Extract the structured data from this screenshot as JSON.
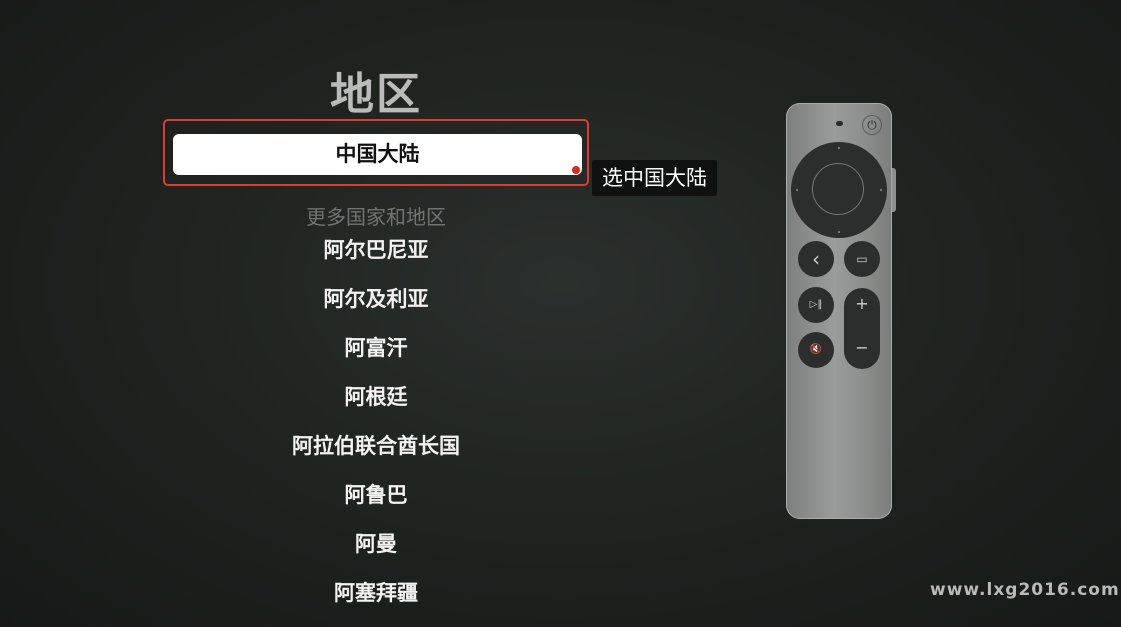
{
  "page": {
    "title": "地区",
    "selected_item": "中国大陆",
    "callout": "选中国大陆",
    "section_header": "更多国家和地区"
  },
  "countries": [
    "阿尔巴尼亚",
    "阿尔及利亚",
    "阿富汗",
    "阿根廷",
    "阿拉伯联合酋长国",
    "阿鲁巴",
    "阿曼",
    "阿塞拜疆"
  ],
  "remote": {
    "back_glyph": "‹",
    "tv_glyph": "▭",
    "playpause_glyph": "▷‖",
    "mute_glyph": "🔇",
    "power_glyph": "⏻",
    "vol_plus": "+",
    "vol_minus": "−"
  },
  "watermark": "www.lxg2016.com",
  "colors": {
    "highlight_border": "#e23a2c",
    "selected_bg": "#ffffff",
    "red_dot": "#e0261b",
    "callout_bg": "#0f1110",
    "remote_body": "#9a9c9b",
    "remote_buttons": "#2c2e2d"
  }
}
